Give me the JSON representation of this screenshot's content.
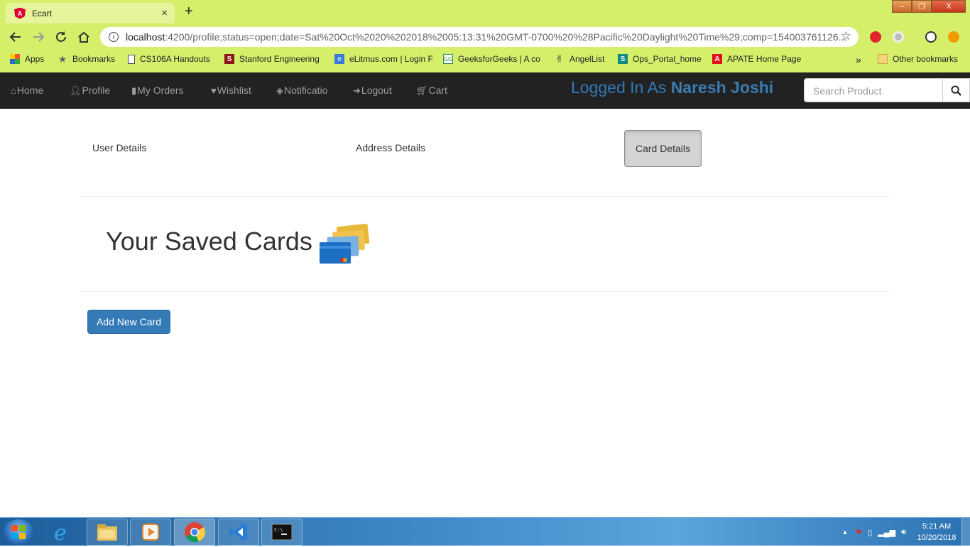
{
  "browser": {
    "tab_title": "Ecart",
    "tab_close": "×",
    "new_tab": "+",
    "url_host": "localhost",
    "url_rest": ":4200/profile;status=open;date=Sat%20Oct%2020%202018%2005:13:31%20GMT-0700%20%28Pacific%20Daylight%20Time%29;comp=154003761126...",
    "window_minimize": "–",
    "window_restore": "❐",
    "window_close": "X",
    "bookmarks": [
      {
        "label": "Apps",
        "icon": "apps-grid-icon"
      },
      {
        "label": "Bookmarks",
        "icon": "star-icon"
      },
      {
        "label": "CS106A Handouts",
        "icon": "page-icon"
      },
      {
        "label": "Stanford Engineering",
        "icon": "stanford-icon"
      },
      {
        "label": "eLitmus.com | Login F",
        "icon": "elitmus-icon"
      },
      {
        "label": "GeeksforGeeks | A co",
        "icon": "gfg-icon"
      },
      {
        "label": "AngelList",
        "icon": "angellist-icon"
      },
      {
        "label": "Ops_Portal_home",
        "icon": "sharepoint-icon"
      },
      {
        "label": "APATE Home Page",
        "icon": "apate-icon"
      }
    ],
    "more_bookmarks": "»",
    "other_bookmarks": "Other bookmarks"
  },
  "navbar": {
    "links": [
      {
        "label": "Home",
        "icon": "home-icon"
      },
      {
        "label": "Profile",
        "icon": "user-icon"
      },
      {
        "label": "My Orders",
        "icon": "book-icon"
      },
      {
        "label": "Wishlist",
        "icon": "heart-icon"
      },
      {
        "label": "Notificatio",
        "icon": "tags-icon"
      },
      {
        "label": "Logout",
        "icon": "log-in-icon"
      },
      {
        "label": "Cart",
        "icon": "cart-icon"
      }
    ],
    "logged_in_prefix": "Logged In As",
    "user_name": "Naresh Joshi",
    "search_placeholder": "Search Product"
  },
  "profile": {
    "tabs": [
      "User Details",
      "Address Details",
      "Card Details"
    ],
    "active_tab": "Card Details",
    "heading": "Your Saved Cards",
    "add_button": "Add New Card"
  },
  "taskbar": {
    "time": "5:21 AM",
    "date": "10/20/2018",
    "apps": [
      "start-orb",
      "internet-explorer",
      "file-explorer",
      "media-player",
      "chrome",
      "visual-studio-code",
      "command-prompt"
    ]
  },
  "colors": {
    "browser_frame": "#d5ef6b",
    "navbar": "#222222",
    "accent": "#337ab7"
  }
}
